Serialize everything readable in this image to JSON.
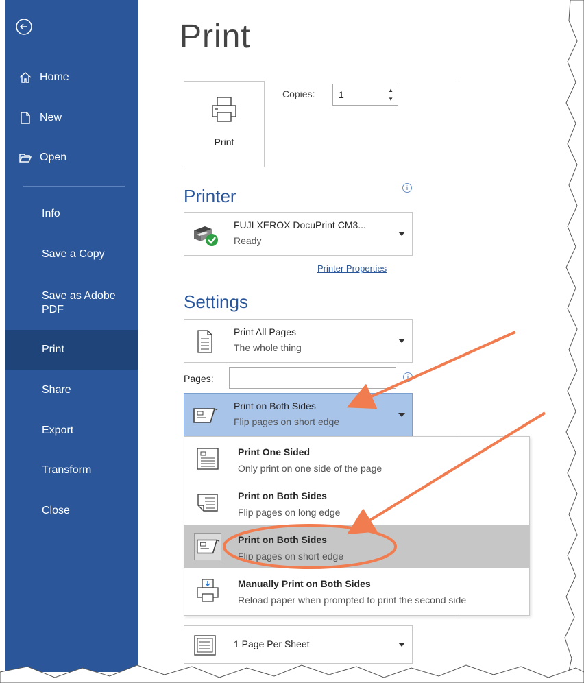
{
  "sidebar": {
    "items": [
      {
        "label": "Home",
        "icon": "home-icon"
      },
      {
        "label": "New",
        "icon": "new-document-icon"
      },
      {
        "label": "Open",
        "icon": "open-folder-icon"
      },
      {
        "label": "Info"
      },
      {
        "label": "Save a Copy"
      },
      {
        "label": "Save as Adobe PDF"
      },
      {
        "label": "Print",
        "active": true
      },
      {
        "label": "Share"
      },
      {
        "label": "Export"
      },
      {
        "label": "Transform"
      },
      {
        "label": "Close"
      }
    ],
    "color": "#2b579a",
    "active_color": "#1e4479"
  },
  "main": {
    "title": "Print",
    "print_button_label": "Print",
    "copies_label": "Copies:",
    "copies_value": "1",
    "printer_heading": "Printer",
    "printer": {
      "name": "FUJI XEROX DocuPrint CM3...",
      "status": "Ready"
    },
    "printer_properties_link": "Printer Properties",
    "settings_heading": "Settings",
    "print_range": {
      "title": "Print All Pages",
      "subtitle": "The whole thing"
    },
    "pages_label": "Pages:",
    "pages_value": "",
    "duplex_selected": {
      "title": "Print on Both Sides",
      "subtitle": "Flip pages on short edge"
    },
    "duplex_menu": [
      {
        "title": "Print One Sided",
        "subtitle": "Only print on one side of the page",
        "icon": "one-sided-icon"
      },
      {
        "title": "Print on Both Sides",
        "subtitle": "Flip pages on long edge",
        "icon": "long-edge-icon"
      },
      {
        "title": "Print on Both Sides",
        "subtitle": "Flip pages on short edge",
        "icon": "short-edge-icon",
        "highlighted": true
      },
      {
        "title": "Manually Print on Both Sides",
        "subtitle": "Reload paper when prompted to print the second side",
        "icon": "manual-duplex-icon"
      }
    ],
    "pages_per_sheet": "1 Page Per Sheet"
  },
  "annotation_color": "#f07c4f"
}
